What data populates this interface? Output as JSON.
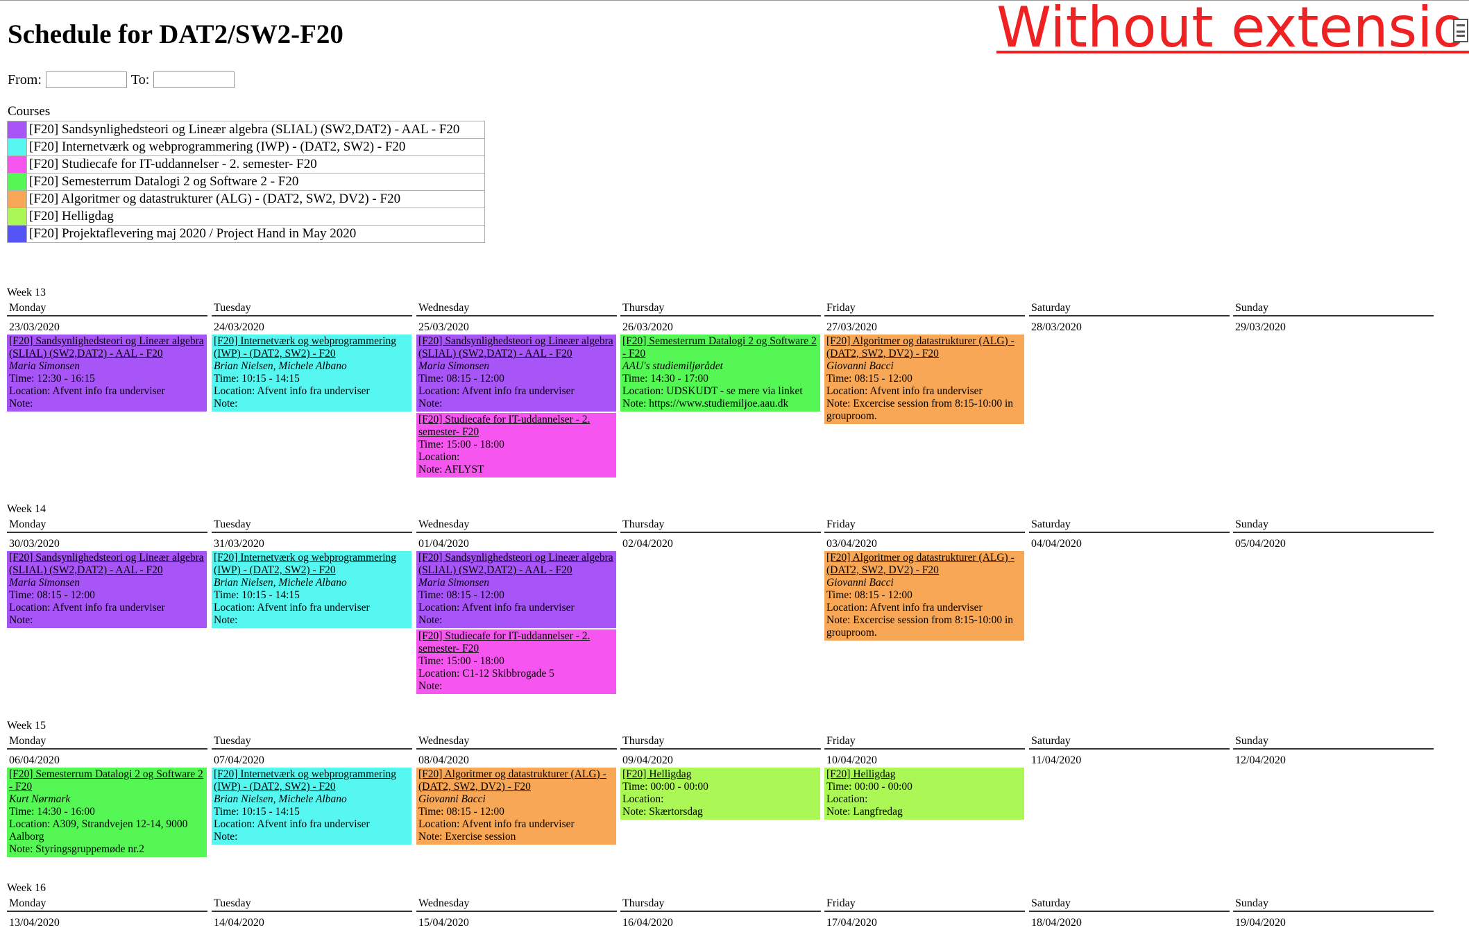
{
  "page": {
    "title": "Schedule for DAT2/SW2-F20",
    "overlay_caption": "Without extension",
    "from_label": "From:",
    "to_label": "To:",
    "from_value": "",
    "to_value": "",
    "courses_label": "Courses"
  },
  "courses": [
    {
      "name": "[F20] Sandsynlighedsteori og Lineær algebra (SLIAL) (SW2,DAT2) - AAL - F20",
      "color": "#a855f7"
    },
    {
      "name": "[F20] Internetværk og webprogrammering (IWP) - (DAT2, SW2) - F20",
      "color": "#55f7f0"
    },
    {
      "name": "[F20] Studiecafe for IT-uddannelser - 2. semester- F20",
      "color": "#f755ef"
    },
    {
      "name": "[F20] Semesterrum Datalogi 2 og Software 2 - F20",
      "color": "#55f755"
    },
    {
      "name": "[F20] Algoritmer og datastrukturer (ALG) - (DAT2, SW2, DV2) - F20",
      "color": "#f7a755"
    },
    {
      "name": "[F20] Helligdag",
      "color": "#aaf755"
    },
    {
      "name": "[F20] Projektaflevering maj 2020 / Project Hand in May 2020",
      "color": "#5555f7"
    }
  ],
  "day_names": [
    "Monday",
    "Tuesday",
    "Wednesday",
    "Thursday",
    "Friday",
    "Saturday",
    "Sunday"
  ],
  "weeks": [
    {
      "label": "Week 13",
      "days": [
        {
          "date": "23/03/2020",
          "events": [
            {
              "color": "#a855f7",
              "title": "[F20] Sandsynlighedsteori og Lineær algebra (SLIAL) (SW2,DAT2) - AAL - F20",
              "teacher": "Maria Simonsen",
              "time": "Time: 12:30 - 16:15",
              "location": "Location: Afvent info fra underviser",
              "note": "Note:"
            }
          ]
        },
        {
          "date": "24/03/2020",
          "events": [
            {
              "color": "#55f7f0",
              "title": "[F20] Internetværk og webprogrammering (IWP) - (DAT2, SW2) - F20",
              "teacher": "Brian Nielsen, Michele Albano",
              "time": "Time: 10:15 - 14:15",
              "location": "Location: Afvent info fra underviser",
              "note": "Note:"
            }
          ]
        },
        {
          "date": "25/03/2020",
          "events": [
            {
              "color": "#a855f7",
              "title": "[F20] Sandsynlighedsteori og Lineær algebra (SLIAL) (SW2,DAT2) - AAL - F20",
              "teacher": "Maria Simonsen",
              "time": "Time: 08:15 - 12:00",
              "location": "Location: Afvent info fra underviser",
              "note": "Note:"
            },
            {
              "color": "#f755ef",
              "title": "[F20] Studiecafe for IT-uddannelser - 2. semester- F20",
              "teacher": "",
              "time": "Time: 15:00 - 18:00",
              "location": "Location:",
              "note": "Note: AFLYST"
            }
          ]
        },
        {
          "date": "26/03/2020",
          "events": [
            {
              "color": "#55f755",
              "title": "[F20] Semesterrum Datalogi 2 og Software 2 - F20",
              "teacher": "AAU's studiemiljørådet",
              "time": "Time: 14:30 - 17:00",
              "location": "Location: UDSKUDT - se mere via linket",
              "note": "Note: https://www.studiemiljoe.aau.dk"
            }
          ]
        },
        {
          "date": "27/03/2020",
          "events": [
            {
              "color": "#f7a755",
              "title": "[F20] Algoritmer og datastrukturer (ALG) - (DAT2, SW2, DV2) - F20",
              "teacher": "Giovanni Bacci",
              "time": "Time: 08:15 - 12:00",
              "location": "Location: Afvent info fra underviser",
              "note": "Note: Excercise session from 8:15-10:00 in grouproom."
            }
          ]
        },
        {
          "date": "28/03/2020",
          "events": []
        },
        {
          "date": "29/03/2020",
          "events": []
        }
      ]
    },
    {
      "label": "Week 14",
      "days": [
        {
          "date": "30/03/2020",
          "events": [
            {
              "color": "#a855f7",
              "title": "[F20] Sandsynlighedsteori og Lineær algebra (SLIAL) (SW2,DAT2) - AAL - F20",
              "teacher": "Maria Simonsen",
              "time": "Time: 08:15 - 12:00",
              "location": "Location: Afvent info fra underviser",
              "note": "Note:"
            }
          ]
        },
        {
          "date": "31/03/2020",
          "events": [
            {
              "color": "#55f7f0",
              "title": "[F20] Internetværk og webprogrammering (IWP) - (DAT2, SW2) - F20",
              "teacher": "Brian Nielsen, Michele Albano",
              "time": "Time: 10:15 - 14:15",
              "location": "Location: Afvent info fra underviser",
              "note": "Note:"
            }
          ]
        },
        {
          "date": "01/04/2020",
          "events": [
            {
              "color": "#a855f7",
              "title": "[F20] Sandsynlighedsteori og Lineær algebra (SLIAL) (SW2,DAT2) - AAL - F20",
              "teacher": "Maria Simonsen",
              "time": "Time: 08:15 - 12:00",
              "location": "Location: Afvent info fra underviser",
              "note": "Note:"
            },
            {
              "color": "#f755ef",
              "title": "[F20] Studiecafe for IT-uddannelser - 2. semester- F20",
              "teacher": "",
              "time": "Time: 15:00 - 18:00",
              "location": "Location: C1-12 Skibbrogade 5",
              "note": "Note:"
            }
          ]
        },
        {
          "date": "02/04/2020",
          "events": []
        },
        {
          "date": "03/04/2020",
          "events": [
            {
              "color": "#f7a755",
              "title": "[F20] Algoritmer og datastrukturer (ALG) - (DAT2, SW2, DV2) - F20",
              "teacher": "Giovanni Bacci",
              "time": "Time: 08:15 - 12:00",
              "location": "Location: Afvent info fra underviser",
              "note": "Note: Excercise session from 8:15-10:00 in grouproom."
            }
          ]
        },
        {
          "date": "04/04/2020",
          "events": []
        },
        {
          "date": "05/04/2020",
          "events": []
        }
      ]
    },
    {
      "label": "Week 15",
      "days": [
        {
          "date": "06/04/2020",
          "events": [
            {
              "color": "#55f755",
              "title": "[F20] Semesterrum Datalogi 2 og Software 2 - F20",
              "teacher": "Kurt Nørmark",
              "time": "Time: 14:30 - 16:00",
              "location": "Location: A309, Strandvejen 12-14, 9000 Aalborg",
              "note": "Note: Styringsgruppemøde nr.2"
            }
          ]
        },
        {
          "date": "07/04/2020",
          "events": [
            {
              "color": "#55f7f0",
              "title": "[F20] Internetværk og webprogrammering (IWP) - (DAT2, SW2) - F20",
              "teacher": "Brian Nielsen, Michele Albano",
              "time": "Time: 10:15 - 14:15",
              "location": "Location: Afvent info fra underviser",
              "note": "Note:"
            }
          ]
        },
        {
          "date": "08/04/2020",
          "events": [
            {
              "color": "#f7a755",
              "title": "[F20] Algoritmer og datastrukturer (ALG) - (DAT2, SW2, DV2) - F20",
              "teacher": "Giovanni Bacci",
              "time": "Time: 08:15 - 12:00",
              "location": "Location: Afvent info fra underviser",
              "note": "Note: Exercise session"
            }
          ]
        },
        {
          "date": "09/04/2020",
          "events": [
            {
              "color": "#aaf755",
              "title": "[F20] Helligdag",
              "teacher": "",
              "time": "Time: 00:00 - 00:00",
              "location": "Location:",
              "note": "Note: Skærtorsdag"
            }
          ]
        },
        {
          "date": "10/04/2020",
          "events": [
            {
              "color": "#aaf755",
              "title": "[F20] Helligdag",
              "teacher": "",
              "time": "Time: 00:00 - 00:00",
              "location": "Location:",
              "note": "Note: Langfredag"
            }
          ]
        },
        {
          "date": "11/04/2020",
          "events": []
        },
        {
          "date": "12/04/2020",
          "events": []
        }
      ]
    },
    {
      "label": "Week 16",
      "days": [
        {
          "date": "13/04/2020",
          "events": []
        },
        {
          "date": "14/04/2020",
          "events": []
        },
        {
          "date": "15/04/2020",
          "events": []
        },
        {
          "date": "16/04/2020",
          "events": []
        },
        {
          "date": "17/04/2020",
          "events": []
        },
        {
          "date": "18/04/2020",
          "events": []
        },
        {
          "date": "19/04/2020",
          "events": []
        }
      ]
    }
  ]
}
